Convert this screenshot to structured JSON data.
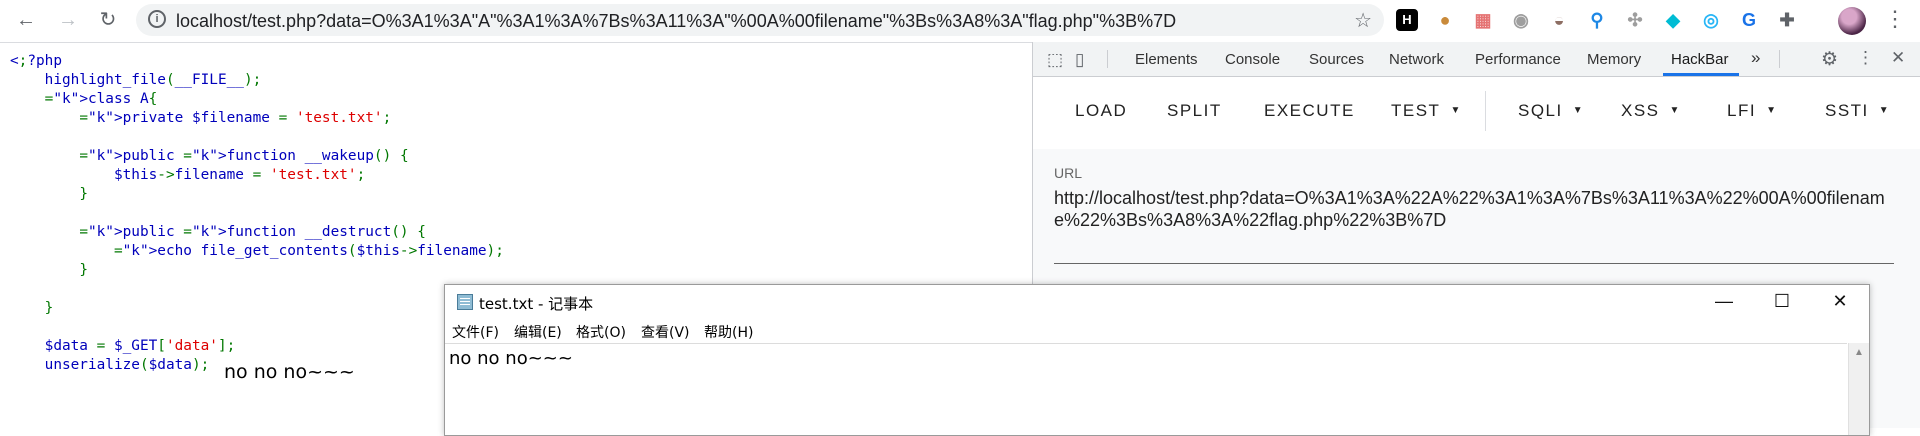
{
  "browser": {
    "back_icon": "back-arrow-icon",
    "forward_icon": "forward-arrow-icon",
    "reload_icon": "reload-icon",
    "url": "localhost/test.php?data=O%3A1%3A\"A\"%3A1%3A%7Bs%3A11%3A\"%00A%00filename\"%3Bs%3A8%3A\"flag.php\"%3B%7D",
    "extensions": [
      {
        "name": "hackbar-h-icon",
        "glyph": "H",
        "color": "#000000"
      },
      {
        "name": "cookie-icon",
        "glyph": "●",
        "color": "#c98a3a"
      },
      {
        "name": "grid-extension-icon",
        "glyph": "▦",
        "color": "#e57373"
      },
      {
        "name": "circle-extension-icon",
        "glyph": "◉",
        "color": "#9e9e9e"
      },
      {
        "name": "hat-extension-icon",
        "glyph": "◒",
        "color": "#8d6e63"
      },
      {
        "name": "pin-extension-icon",
        "glyph": "⚲",
        "color": "#1e88e5"
      },
      {
        "name": "network-extension-icon",
        "glyph": "✣",
        "color": "#9e9e9e"
      },
      {
        "name": "cube-extension-icon",
        "glyph": "◆",
        "color": "#00bcd4"
      },
      {
        "name": "eye-extension-icon",
        "glyph": "◎",
        "color": "#29b6f6"
      },
      {
        "name": "translate-extension-icon",
        "glyph": "G",
        "color": "#1a73e8"
      },
      {
        "name": "puzzle-extensions-icon",
        "glyph": "✚",
        "color": "#5f6368"
      }
    ]
  },
  "code_lines": [
    "<?php",
    "    highlight_file(__FILE__);",
    "    class A{",
    "        private $filename = 'test.txt';",
    "",
    "        public function __wakeup() {",
    "            $this->filename = 'test.txt';",
    "        }",
    "",
    "        public function __destruct() {",
    "            echo file_get_contents($this->filename);",
    "        }",
    "",
    "    }",
    "",
    "    $data = $_GET['data'];",
    "    unserialize($data);"
  ],
  "echo_output": "no no no~~~",
  "devtools": {
    "tabs": [
      "Elements",
      "Console",
      "Sources",
      "Network",
      "Performance",
      "Memory",
      "HackBar"
    ],
    "active_tab": "HackBar",
    "more_tabs": "»"
  },
  "hackbar": {
    "buttons": [
      "LOAD",
      "SPLIT",
      "EXECUTE",
      "TEST"
    ],
    "dropdowns": [
      "SQLI",
      "XSS",
      "LFI",
      "SSTI"
    ],
    "url_label": "URL",
    "url_value": "http://localhost/test.php?data=O%3A1%3A%22A%22%3A1%3A%7Bs%3A11%3A%22%00A%00filename%22%3Bs%3A8%3A%22flag.php%22%3B%7D"
  },
  "notepad": {
    "title": "test.txt - 记事本",
    "menu": [
      "文件(F)",
      "编辑(E)",
      "格式(O)",
      "查看(V)",
      "帮助(H)"
    ],
    "content": "no no no~~~",
    "minimize": "—",
    "maximize": "☐",
    "close": "✕"
  }
}
